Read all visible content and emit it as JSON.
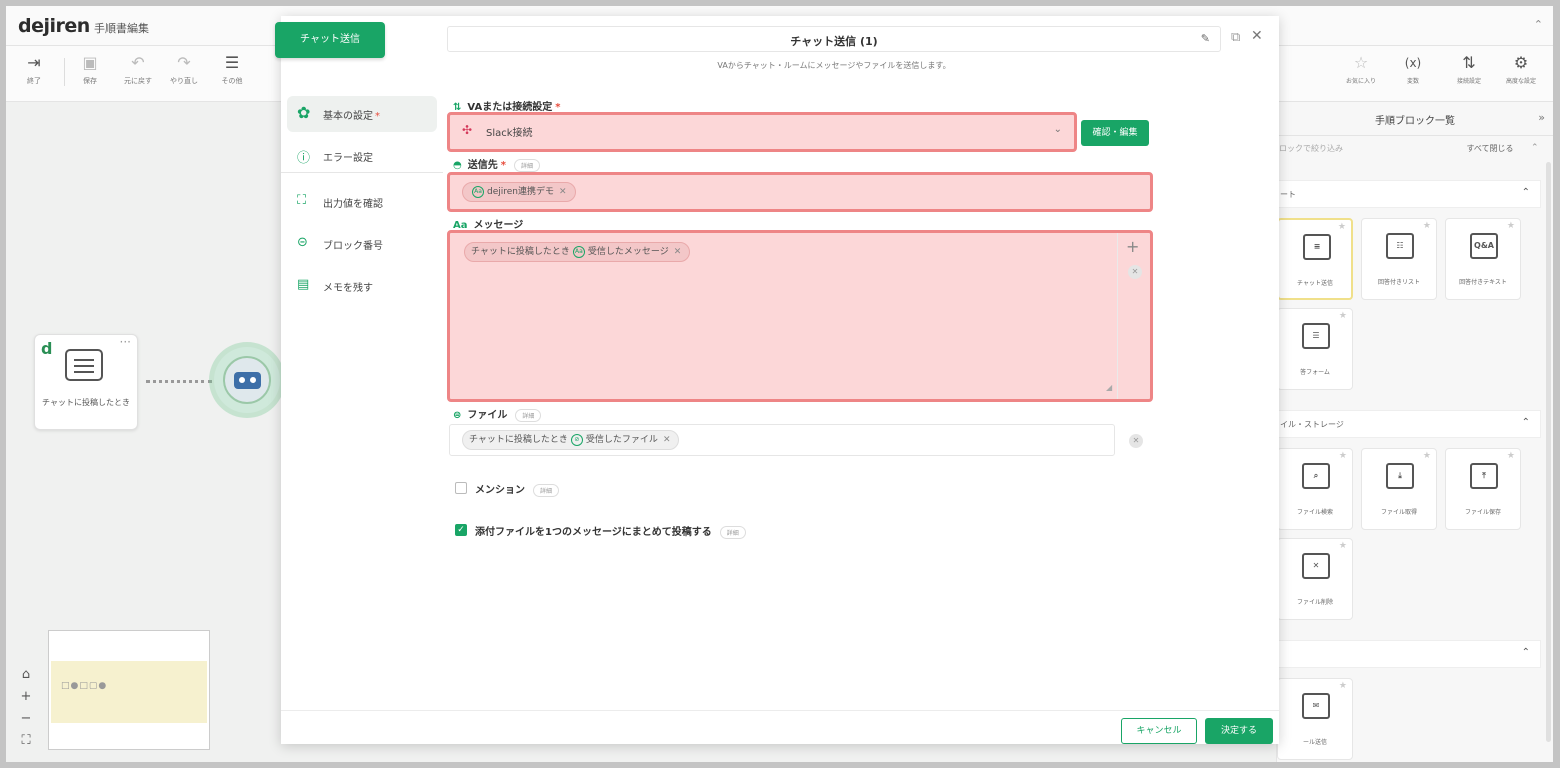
{
  "app": {
    "logo": "dejiren",
    "doc_title": "手順書編集"
  },
  "toolbar": [
    {
      "icon": "exit-icon",
      "glyph": "⇥",
      "label": "終了",
      "dim": false
    },
    {
      "icon": "save-icon",
      "glyph": "▣",
      "label": "保存",
      "dim": true
    },
    {
      "icon": "undo-icon",
      "glyph": "↶",
      "label": "元に戻す",
      "dim": true
    },
    {
      "icon": "redo-icon",
      "glyph": "↷",
      "label": "やり直し",
      "dim": true
    },
    {
      "icon": "menu-icon",
      "glyph": "☰",
      "label": "その他",
      "dim": false
    }
  ],
  "right_toolbar": [
    {
      "icon": "star-icon",
      "glyph": "☆",
      "label": "お気に入り"
    },
    {
      "icon": "variable-icon",
      "glyph": "(x)",
      "label": "変数"
    },
    {
      "icon": "connection-icon",
      "glyph": "⇅",
      "label": "接続設定"
    },
    {
      "icon": "advanced-settings-icon",
      "glyph": "⚙",
      "label": "高度な設定"
    }
  ],
  "right_panel": {
    "title": "手順ブロック一覧",
    "filter_placeholder": "ロックで絞り込み",
    "close_all": "すべて閉じる",
    "sections": [
      "ート",
      "イル・ストレージ",
      ""
    ],
    "cards": [
      {
        "label": "チャット送信",
        "icon_text": "",
        "highlighted": true
      },
      {
        "label": "回答付きリスト",
        "icon_text": "",
        "highlighted": false
      },
      {
        "label": "回答付きテキスト",
        "icon_text": "Q&A",
        "highlighted": false
      },
      {
        "label": "答フォーム",
        "icon_text": "",
        "highlighted": false
      },
      {
        "label": "ファイル検索",
        "icon_text": "",
        "highlighted": false
      },
      {
        "label": "ファイル取得",
        "icon_text": "",
        "highlighted": false
      },
      {
        "label": "ファイル保存",
        "icon_text": "",
        "highlighted": false
      },
      {
        "label": "ファイル削除",
        "icon_text": "",
        "highlighted": false
      },
      {
        "label": "ール送信",
        "icon_text": "",
        "highlighted": false
      }
    ]
  },
  "canvas": {
    "node_label": "チャットに投稿したとき"
  },
  "modal": {
    "tab": "チャット送信",
    "title": "チャット送信 (1)",
    "subtitle": "VAからチャット・ルームにメッセージやファイルを送信します。",
    "nav": [
      {
        "label": "基本の設定",
        "icon": "gear-icon",
        "glyph": "✿",
        "active": true,
        "required": true
      },
      {
        "label": "エラー設定",
        "icon": "error-icon",
        "glyph": "ⓘ",
        "active": false,
        "required": false
      },
      {
        "label": "出力値を確認",
        "icon": "output-icon",
        "glyph": "⛶",
        "active": false,
        "required": false
      },
      {
        "label": "ブロック番号",
        "icon": "block-number-icon",
        "glyph": "⊝",
        "active": false,
        "required": false
      },
      {
        "label": "メモを残す",
        "icon": "memo-icon",
        "glyph": "▤",
        "active": false,
        "required": false
      }
    ],
    "req_mark": "*",
    "detail": "詳細",
    "connection": {
      "label": "VAまたは接続設定",
      "value": "Slack接続",
      "confirm": "確認・編集"
    },
    "destination": {
      "label": "送信先",
      "chip": "dejiren連携デモ"
    },
    "message": {
      "label": "メッセージ",
      "chip_prefix": "チャットに投稿したとき",
      "chip_value": "受信したメッセージ"
    },
    "file": {
      "label": "ファイル",
      "chip_prefix": "チャットに投稿したとき",
      "chip_value": "受信したファイル"
    },
    "mention": {
      "label": "メンション",
      "checked": false
    },
    "bundle": {
      "label": "添付ファイルを1つのメッセージにまとめて投稿する",
      "checked": true
    },
    "cancel": "キャンセル",
    "ok": "決定する"
  },
  "colors": {
    "accent": "#19a566",
    "highlight_fill": "#fcd7d8",
    "highlight_border": "#ee8586"
  }
}
